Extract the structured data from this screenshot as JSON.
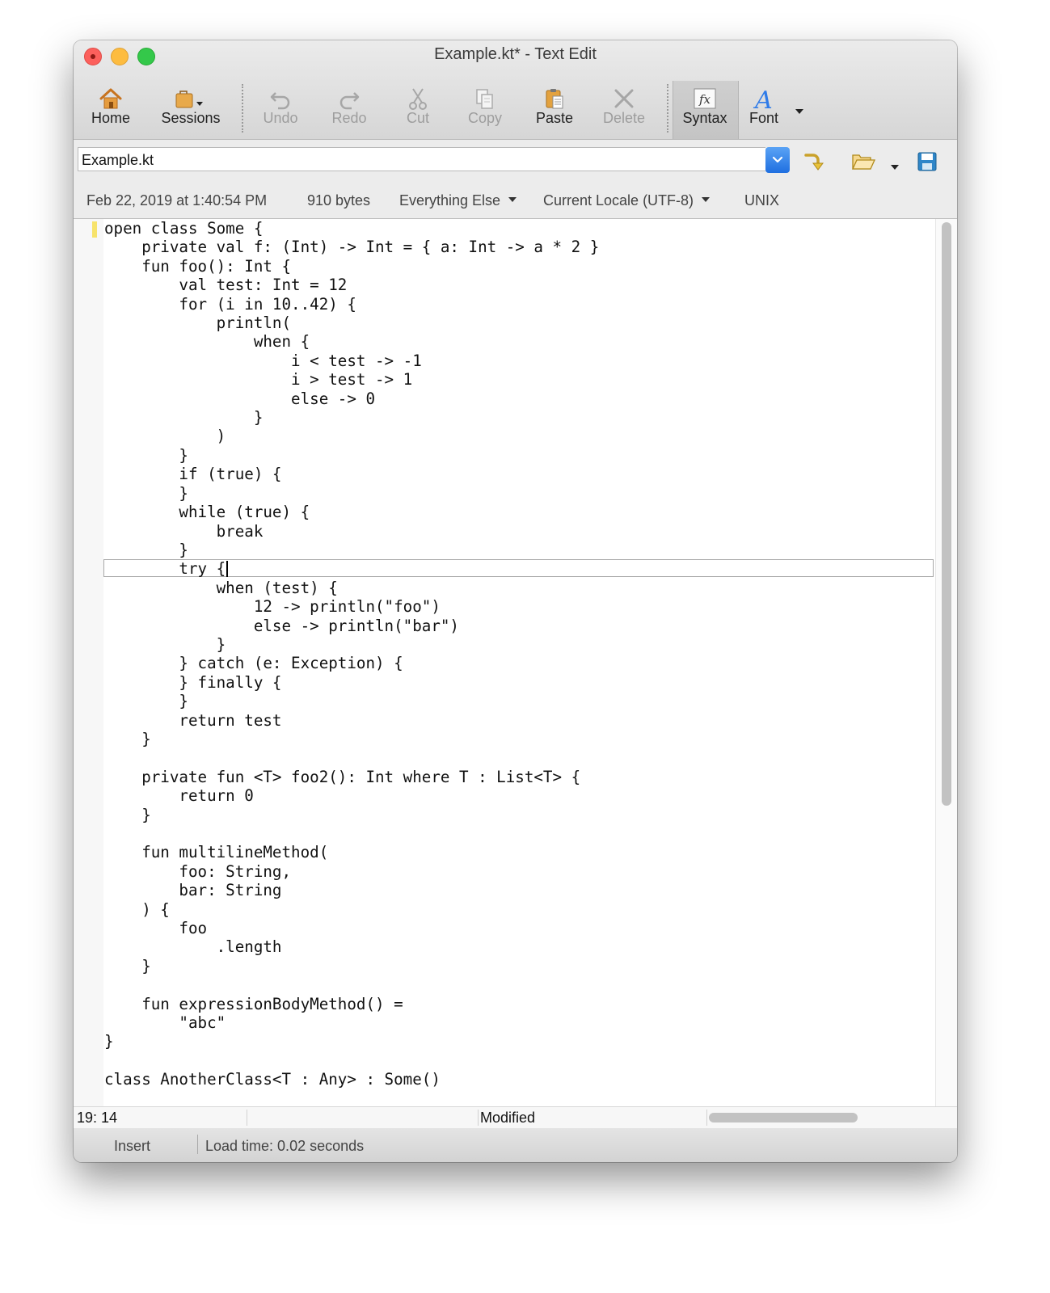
{
  "window": {
    "title": "Example.kt* - Text Edit"
  },
  "toolbar": {
    "home": "Home",
    "sessions": "Sessions",
    "undo": "Undo",
    "redo": "Redo",
    "cut": "Cut",
    "copy": "Copy",
    "paste": "Paste",
    "delete": "Delete",
    "syntax": "Syntax",
    "font": "Font"
  },
  "path": {
    "value": "Example.kt"
  },
  "info": {
    "date": "Feb 22, 2019 at 1:40:54 PM",
    "size": "910 bytes",
    "syntax_mode": "Everything Else",
    "encoding": "Current Locale (UTF-8)",
    "line_endings": "UNIX"
  },
  "editor": {
    "code": "open class Some {\n    private val f: (Int) -> Int = { a: Int -> a * 2 }\n    fun foo(): Int {\n        val test: Int = 12\n        for (i in 10..42) {\n            println(\n                when {\n                    i < test -> -1\n                    i > test -> 1\n                    else -> 0\n                }\n            )\n        }\n        if (true) {\n        }\n        while (true) {\n            break\n        }\n        try {\n            when (test) {\n                12 -> println(\"foo\")\n                else -> println(\"bar\")\n            }\n        } catch (e: Exception) {\n        } finally {\n        }\n        return test\n    }\n\n    private fun <T> foo2(): Int where T : List<T> {\n        return 0\n    }\n\n    fun multilineMethod(\n        foo: String,\n        bar: String\n    ) {\n        foo\n            .length\n    }\n\n    fun expressionBodyMethod() =\n        \"abc\"\n}\n\nclass AnotherClass<T : Any> : Some()"
  },
  "status": {
    "position": "19: 14",
    "state": "Modified",
    "mode": "Insert",
    "load_time": "Load time: 0.02 seconds"
  },
  "colors": {
    "accent": "#2f7be8",
    "icon_orange": "#d98a2b",
    "change_marker": "#f7e36b"
  },
  "icons": [
    "home-icon",
    "sessions-icon",
    "undo-icon",
    "redo-icon",
    "cut-icon",
    "copy-icon",
    "paste-icon",
    "delete-icon",
    "syntax-fx-icon",
    "font-icon",
    "chevron-down-icon",
    "go-to-icon",
    "open-folder-icon",
    "save-icon"
  ]
}
